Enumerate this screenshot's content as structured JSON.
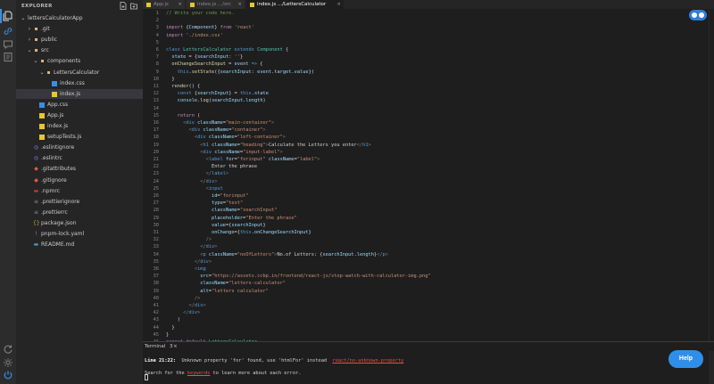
{
  "sidebar": {
    "title": "EXPLORER",
    "tree": [
      {
        "label": "lettersCalculatorApp",
        "depth": 0,
        "kind": "folder-open",
        "icon": "chevron-down-icon"
      },
      {
        "label": ".git",
        "depth": 1,
        "kind": "folder",
        "icon": "git-folder-icon"
      },
      {
        "label": "public",
        "depth": 1,
        "kind": "folder",
        "icon": "folder-icon"
      },
      {
        "label": "src",
        "depth": 1,
        "kind": "folder-open",
        "icon": "folder-icon"
      },
      {
        "label": "components",
        "depth": 2,
        "kind": "folder-open",
        "icon": "folder-icon"
      },
      {
        "label": "LettersCalculator",
        "depth": 3,
        "kind": "folder-open",
        "icon": "folder-icon"
      },
      {
        "label": "index.css",
        "depth": 4,
        "kind": "css",
        "icon": "css-file-icon"
      },
      {
        "label": "index.js",
        "depth": 4,
        "kind": "js",
        "icon": "js-file-icon",
        "selected": true
      },
      {
        "label": "App.css",
        "depth": 2,
        "kind": "css",
        "icon": "css-file-icon"
      },
      {
        "label": "App.js",
        "depth": 2,
        "kind": "js",
        "icon": "js-file-icon"
      },
      {
        "label": "index.js",
        "depth": 2,
        "kind": "js",
        "icon": "js-file-icon"
      },
      {
        "label": "setupTests.js",
        "depth": 2,
        "kind": "js",
        "icon": "js-file-icon"
      },
      {
        "label": ".eslintignore",
        "depth": 1,
        "kind": "eslint",
        "icon": "eslint-icon"
      },
      {
        "label": ".eslintrc",
        "depth": 1,
        "kind": "eslint",
        "icon": "eslint-icon"
      },
      {
        "label": ".gitattributes",
        "depth": 1,
        "kind": "git",
        "icon": "git-file-icon"
      },
      {
        "label": ".gitignore",
        "depth": 1,
        "kind": "git",
        "icon": "git-file-icon"
      },
      {
        "label": ".npmrc",
        "depth": 1,
        "kind": "npm",
        "icon": "npm-icon"
      },
      {
        "label": ".prettierignore",
        "depth": 1,
        "kind": "lines",
        "icon": "prettier-icon"
      },
      {
        "label": ".prettierrc",
        "depth": 1,
        "kind": "lines",
        "icon": "prettier-icon"
      },
      {
        "label": "package.json",
        "depth": 1,
        "kind": "json",
        "icon": "json-file-icon"
      },
      {
        "label": "pnpm-lock.yaml",
        "depth": 1,
        "kind": "yaml",
        "icon": "yaml-file-icon"
      },
      {
        "label": "README.md",
        "depth": 1,
        "kind": "md",
        "icon": "markdown-file-icon"
      }
    ]
  },
  "tabs": [
    {
      "label": "App.js",
      "active": false
    },
    {
      "label": "index.js .../src",
      "active": false
    },
    {
      "label": "index.js .../LettersCalculator",
      "active": true
    }
  ],
  "code_lines": [
    [
      [
        "c",
        "// Write your code here.  "
      ]
    ],
    [],
    [
      [
        "k",
        "import "
      ],
      [
        "d",
        "{"
      ],
      [
        "v",
        "Component"
      ],
      [
        "d",
        "} "
      ],
      [
        "k",
        "from "
      ],
      [
        "s",
        "'react'"
      ]
    ],
    [
      [
        "k",
        "import "
      ],
      [
        "s",
        "'./index.css'"
      ]
    ],
    [],
    [
      [
        "b",
        "class "
      ],
      [
        "t",
        "LettersCalculator "
      ],
      [
        "b",
        "extends "
      ],
      [
        "t",
        "Component "
      ],
      [
        "d",
        "{"
      ]
    ],
    [
      [
        "d",
        "  "
      ],
      [
        "v",
        "state "
      ],
      [
        "d",
        "= {"
      ],
      [
        "v",
        "searchInput"
      ],
      [
        "d",
        ": "
      ],
      [
        "s",
        "''"
      ],
      [
        "d",
        "}"
      ]
    ],
    [
      [
        "d",
        "  "
      ],
      [
        "f",
        "onChangeSearchInput "
      ],
      [
        "d",
        "= "
      ],
      [
        "v",
        "event "
      ],
      [
        "b",
        "=> "
      ],
      [
        "d",
        "{"
      ]
    ],
    [
      [
        "d",
        "    "
      ],
      [
        "b",
        "this"
      ],
      [
        "d",
        "."
      ],
      [
        "f",
        "setState"
      ],
      [
        "d",
        "({"
      ],
      [
        "v",
        "searchInput"
      ],
      [
        "d",
        ": "
      ],
      [
        "v",
        "event"
      ],
      [
        "d",
        "."
      ],
      [
        "v",
        "target"
      ],
      [
        "d",
        "."
      ],
      [
        "v",
        "value"
      ],
      [
        "d",
        "})"
      ]
    ],
    [
      [
        "d",
        "  }"
      ]
    ],
    [
      [
        "d",
        "  "
      ],
      [
        "f",
        "render"
      ],
      [
        "d",
        "() {"
      ]
    ],
    [
      [
        "d",
        "    "
      ],
      [
        "b",
        "const "
      ],
      [
        "d",
        "{"
      ],
      [
        "v",
        "searchInput"
      ],
      [
        "d",
        "} = "
      ],
      [
        "b",
        "this"
      ],
      [
        "d",
        "."
      ],
      [
        "v",
        "state"
      ]
    ],
    [
      [
        "d",
        "    "
      ],
      [
        "v",
        "console"
      ],
      [
        "d",
        "."
      ],
      [
        "f",
        "log"
      ],
      [
        "d",
        "("
      ],
      [
        "v",
        "searchInput"
      ],
      [
        "d",
        "."
      ],
      [
        "v",
        "length"
      ],
      [
        "d",
        ")"
      ]
    ],
    [],
    [
      [
        "d",
        "    "
      ],
      [
        "k",
        "return "
      ],
      [
        "d",
        "("
      ]
    ],
    [
      [
        "d",
        "      "
      ],
      [
        "g",
        "<"
      ],
      [
        "tg",
        "div "
      ],
      [
        "a",
        "className"
      ],
      [
        "d",
        "="
      ],
      [
        "s",
        "\"main-container\""
      ],
      [
        "g",
        ">"
      ]
    ],
    [
      [
        "d",
        "        "
      ],
      [
        "g",
        "<"
      ],
      [
        "tg",
        "div "
      ],
      [
        "a",
        "className"
      ],
      [
        "d",
        "="
      ],
      [
        "s",
        "\"container\""
      ],
      [
        "g",
        ">"
      ]
    ],
    [
      [
        "d",
        "          "
      ],
      [
        "g",
        "<"
      ],
      [
        "tg",
        "div "
      ],
      [
        "a",
        "className"
      ],
      [
        "d",
        "="
      ],
      [
        "s",
        "\"left-container\""
      ],
      [
        "g",
        ">"
      ]
    ],
    [
      [
        "d",
        "            "
      ],
      [
        "g",
        "<"
      ],
      [
        "tg",
        "h1 "
      ],
      [
        "a",
        "className"
      ],
      [
        "d",
        "="
      ],
      [
        "s",
        "\"heading\""
      ],
      [
        "g",
        ">"
      ],
      [
        "d",
        "Calculate the Letters you enter"
      ],
      [
        "g",
        "</"
      ],
      [
        "tg",
        "h1"
      ],
      [
        "g",
        ">"
      ]
    ],
    [
      [
        "d",
        "            "
      ],
      [
        "g",
        "<"
      ],
      [
        "tg",
        "div "
      ],
      [
        "a",
        "className"
      ],
      [
        "d",
        "="
      ],
      [
        "s",
        "\"input-label\""
      ],
      [
        "g",
        ">"
      ]
    ],
    [
      [
        "d",
        "              "
      ],
      [
        "g",
        "<"
      ],
      [
        "tg",
        "label "
      ],
      [
        "a",
        "for"
      ],
      [
        "d",
        "="
      ],
      [
        "s",
        "\"forinput\" "
      ],
      [
        "a",
        "className"
      ],
      [
        "d",
        "="
      ],
      [
        "s",
        "\"label\""
      ],
      [
        "g",
        ">"
      ]
    ],
    [
      [
        "d",
        "                Enter the phrase"
      ]
    ],
    [
      [
        "d",
        "              "
      ],
      [
        "g",
        "</"
      ],
      [
        "tg",
        "label"
      ],
      [
        "g",
        ">"
      ]
    ],
    [
      [
        "d",
        "            "
      ],
      [
        "g",
        "</"
      ],
      [
        "tg",
        "div"
      ],
      [
        "g",
        ">"
      ]
    ],
    [
      [
        "d",
        "              "
      ],
      [
        "g",
        "<"
      ],
      [
        "tg",
        "input"
      ]
    ],
    [
      [
        "d",
        "                "
      ],
      [
        "a",
        "id"
      ],
      [
        "d",
        "="
      ],
      [
        "s",
        "\"forinput\""
      ]
    ],
    [
      [
        "d",
        "                "
      ],
      [
        "a",
        "type"
      ],
      [
        "d",
        "="
      ],
      [
        "s",
        "\"text\""
      ]
    ],
    [
      [
        "d",
        "                "
      ],
      [
        "a",
        "className"
      ],
      [
        "d",
        "="
      ],
      [
        "s",
        "\"searchInput\""
      ]
    ],
    [
      [
        "d",
        "                "
      ],
      [
        "a",
        "placeholder"
      ],
      [
        "d",
        "="
      ],
      [
        "s",
        "\"Enter the phrase\""
      ]
    ],
    [
      [
        "d",
        "                "
      ],
      [
        "a",
        "value"
      ],
      [
        "d",
        "={"
      ],
      [
        "v",
        "searchInput"
      ],
      [
        "d",
        "}"
      ]
    ],
    [
      [
        "d",
        "                "
      ],
      [
        "a",
        "onChange"
      ],
      [
        "d",
        "={"
      ],
      [
        "b",
        "this"
      ],
      [
        "d",
        "."
      ],
      [
        "v",
        "onChangeSearchInput"
      ],
      [
        "d",
        "}"
      ]
    ],
    [
      [
        "d",
        "              "
      ],
      [
        "g",
        "/>"
      ]
    ],
    [
      [
        "d",
        "            "
      ],
      [
        "g",
        "</"
      ],
      [
        "tg",
        "div"
      ],
      [
        "g",
        ">"
      ]
    ],
    [
      [
        "d",
        "            "
      ],
      [
        "g",
        "<"
      ],
      [
        "tg",
        "p "
      ],
      [
        "a",
        "className"
      ],
      [
        "d",
        "="
      ],
      [
        "s",
        "\"noOfLetters\""
      ],
      [
        "g",
        ">"
      ],
      [
        "d",
        "No.of Letters: {"
      ],
      [
        "v",
        "searchInput"
      ],
      [
        "d",
        "."
      ],
      [
        "v",
        "length"
      ],
      [
        "d",
        "}"
      ],
      [
        "g",
        "</"
      ],
      [
        "tg",
        "p"
      ],
      [
        "g",
        ">"
      ]
    ],
    [
      [
        "d",
        "          "
      ],
      [
        "g",
        "</"
      ],
      [
        "tg",
        "div"
      ],
      [
        "g",
        ">"
      ]
    ],
    [
      [
        "d",
        "          "
      ],
      [
        "g",
        "<"
      ],
      [
        "tg",
        "img"
      ]
    ],
    [
      [
        "d",
        "            "
      ],
      [
        "a",
        "src"
      ],
      [
        "d",
        "="
      ],
      [
        "s",
        "\"https://assets.ccbp.in/frontend/react-js/stop-watch-with-calculator-img.png\""
      ]
    ],
    [
      [
        "d",
        "            "
      ],
      [
        "a",
        "className"
      ],
      [
        "d",
        "="
      ],
      [
        "s",
        "\"letters-calculator\""
      ]
    ],
    [
      [
        "d",
        "            "
      ],
      [
        "a",
        "alt"
      ],
      [
        "d",
        "="
      ],
      [
        "s",
        "\"letters calculator\""
      ]
    ],
    [
      [
        "d",
        "          "
      ],
      [
        "g",
        "/>"
      ]
    ],
    [
      [
        "d",
        "        "
      ],
      [
        "g",
        "</"
      ],
      [
        "tg",
        "div"
      ],
      [
        "g",
        ">"
      ]
    ],
    [
      [
        "d",
        "      "
      ],
      [
        "g",
        "</"
      ],
      [
        "tg",
        "div"
      ],
      [
        "g",
        ">"
      ]
    ],
    [
      [
        "d",
        "    )"
      ]
    ],
    [
      [
        "d",
        "  }"
      ]
    ],
    [
      [
        "d",
        "}"
      ]
    ],
    [
      [
        "k",
        "export default "
      ],
      [
        "t",
        "LettersCalculator"
      ]
    ],
    []
  ],
  "terminal": {
    "tab_label": "Terminal",
    "tab_count": "3",
    "close_glyph": "×",
    "error_line_label": "Line 21:22:",
    "error_message": "  Unknown property 'for' found, use 'htmlFor' instead  ",
    "error_rule": "react/no-unknown-property",
    "search_prefix": "Search for the ",
    "search_keywords": "keywords",
    "search_suffix": " to learn more about each error."
  },
  "help_button": {
    "label": "Help"
  },
  "colors": {
    "accent": "#2f8fe8",
    "error": "#f14c4c"
  }
}
